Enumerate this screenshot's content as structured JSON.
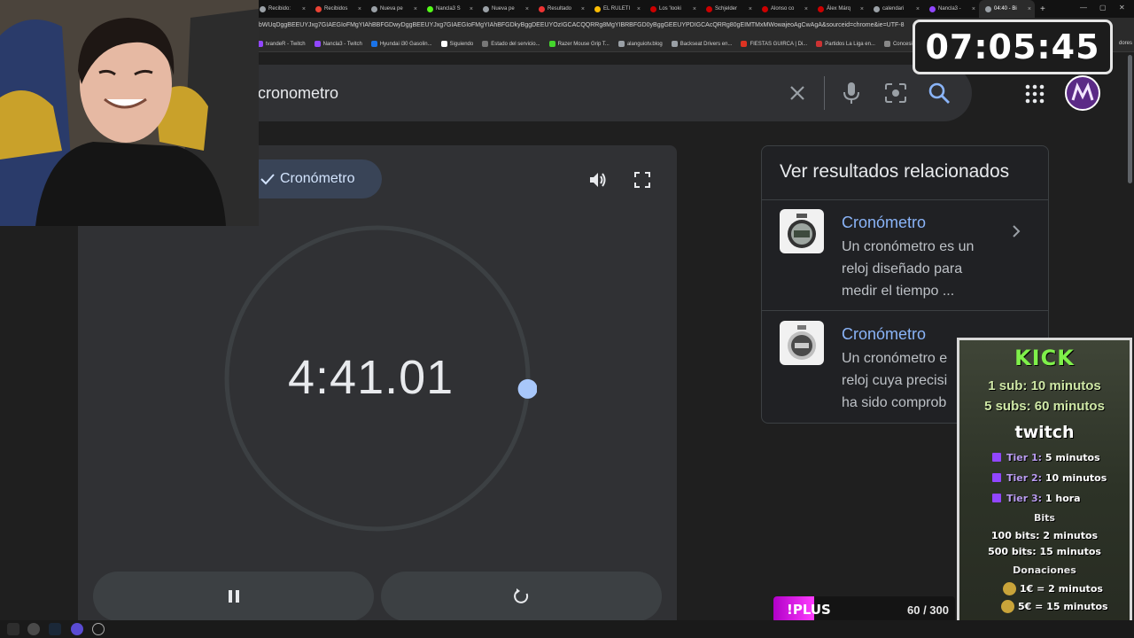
{
  "browser": {
    "tabs": [
      {
        "label": "Recibido:",
        "color": "#9aa0a6"
      },
      {
        "label": "Recibidos",
        "color": "#ea4335"
      },
      {
        "label": "Nueva pe",
        "color": "#9aa0a6"
      },
      {
        "label": "Nancla3 S",
        "color": "#53fc18"
      },
      {
        "label": "Nueva pe",
        "color": "#9aa0a6"
      },
      {
        "label": "Resultado",
        "color": "#e33"
      },
      {
        "label": "EL RULETI",
        "color": "#fbbc04"
      },
      {
        "label": "Los 'looki",
        "color": "#c00"
      },
      {
        "label": "Schjelder",
        "color": "#c00"
      },
      {
        "label": "Alonso co",
        "color": "#c00"
      },
      {
        "label": "Álex Márq",
        "color": "#c00"
      },
      {
        "label": "calendari",
        "color": "#9aa0a6"
      },
      {
        "label": "Nancla3 -",
        "color": "#9146ff"
      },
      {
        "label": "04:40 - Bi",
        "color": "#9aa0a6",
        "active": true
      }
    ],
    "url": "bWUqDggBEEUYJxg7GIAEGIoFMgYIAhBBFGDwyDggBEEUYJxg7GIAEGIoFMgYIAhBFGDkyBggDEEUYOzIGCACQQRRg8MgYIBRBFGD0yBggGEEUYPDIGCAcQRRg80gEIMTMxMWowajeoAgCwAgA&sourceid=chrome&ie=UTF-8",
    "bookmarks": [
      "tvandeR - Twitch",
      "Nancla3 - Twitch",
      "Hyundai i30 Gasolin...",
      "Siguiendo",
      "Estado del servicio...",
      "Razer Mouse Grip T...",
      "alanguiotv.blog",
      "Backseat Drivers en...",
      "FIESTAS GUIRCA | Di...",
      "Partidos La Liga en...",
      "Concesion"
    ],
    "bookmarks_overflow": "dores"
  },
  "search": {
    "query": "cronometro"
  },
  "stopwatch": {
    "mode_label": "Cronómetro",
    "time": "4:41.01",
    "progress_fraction": 0.683
  },
  "related": {
    "title": "Ver resultados relacionados",
    "items": [
      {
        "name": "Cronómetro",
        "desc": "Un cronómetro es un reloj diseñado para medir el tiempo ..."
      },
      {
        "name": "Cronómetro",
        "desc": "Un cronómetro e reloj cuya precisi ha sido comprob"
      }
    ]
  },
  "overlay": {
    "clock": "07:05:45",
    "kick_title": "KICK",
    "kick_lines": [
      "1 sub: 10 minutos",
      "5 subs: 60 minutos"
    ],
    "twitch_title": "twitch",
    "tiers": [
      {
        "label": "Tier 1:",
        "value": "5 minutos"
      },
      {
        "label": "Tier 2:",
        "value": "10 minutos"
      },
      {
        "label": "Tier 3:",
        "value": "1 hora"
      }
    ],
    "bits_title": "Bits",
    "bits_lines": [
      "100 bits: 2 minutos",
      "500 bits: 15 minutos"
    ],
    "donations_title": "Donaciones",
    "donation_lines": [
      "1€ = 2 minutos",
      "5€ = 15 minutos"
    ],
    "plus_label": "!PLUS",
    "plus_count": "60 / 300"
  },
  "colors": {
    "page_bg": "#1f1f1f",
    "card_bg": "#303134",
    "accent_blue": "#8ab4f8",
    "kick_green": "#53fc18",
    "twitch_purple": "#9146ff"
  }
}
